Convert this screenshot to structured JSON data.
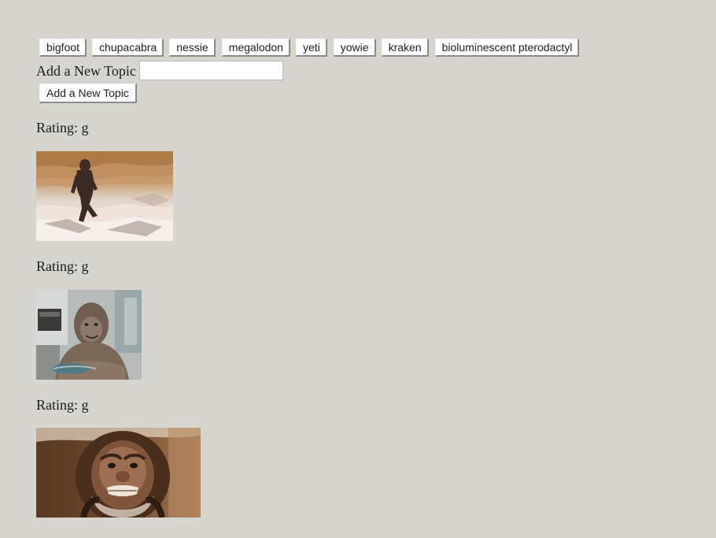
{
  "topics": [
    "bigfoot",
    "chupacabra",
    "nessie",
    "megalodon",
    "yeti",
    "yowie",
    "kraken",
    "bioluminescent pterodactyl"
  ],
  "add_topic": {
    "label": "Add a New Topic",
    "input_value": "",
    "button_label": "Add a New Topic"
  },
  "results": [
    {
      "rating_text": "Rating: g",
      "image": "bigfoot-walking-gif"
    },
    {
      "rating_text": "Rating: g",
      "image": "sasquatch-sitting-gif"
    },
    {
      "rating_text": "Rating: g",
      "image": "harry-sasquatch-face-gif"
    }
  ]
}
